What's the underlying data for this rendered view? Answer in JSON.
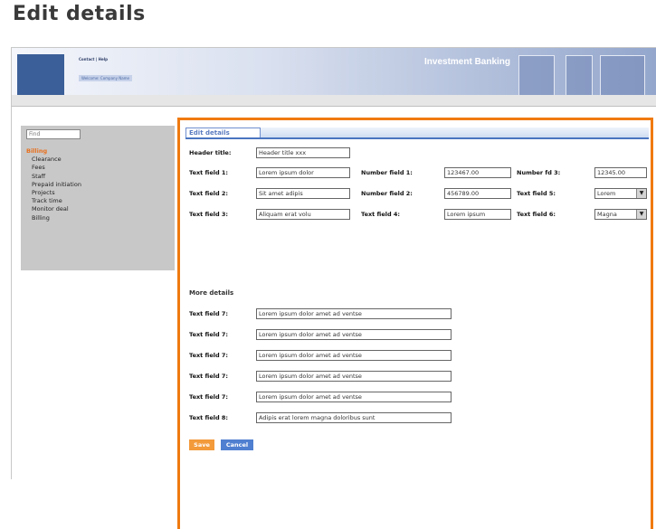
{
  "page_title": "Edit details",
  "banner": {
    "links": "Contact | Help",
    "subtitle": "Welcome: Company Name",
    "title": "Investment Banking"
  },
  "sidebar": {
    "search_placeholder": "Find",
    "items": [
      {
        "label": "Billing",
        "active": true
      },
      {
        "label": "Clearance"
      },
      {
        "label": "Fees"
      },
      {
        "label": "Staff"
      },
      {
        "label": "Prepaid initiation"
      },
      {
        "label": "Projects"
      },
      {
        "label": "Track time"
      },
      {
        "label": "Monitor deal"
      },
      {
        "label": "Billing"
      }
    ]
  },
  "form": {
    "tab_label": "Edit details",
    "header_title_label": "Header title:",
    "header_title_value": "Header title xxx",
    "row1": {
      "text1_label": "Text field 1:",
      "text1_value": "Lorem ipsum dolor",
      "num1_label": "Number field 1:",
      "num1_value": "123467.00",
      "num_fd3_label": "Number fd 3:",
      "num_fd3_value": "12345.00"
    },
    "row2": {
      "text2_label": "Text field 2:",
      "text2_value": "Sit amet adipis",
      "num2_label": "Number field 2:",
      "num2_value": "456789.00",
      "text5_label": "Text field 5:",
      "text5_value": "Lorem"
    },
    "row3": {
      "text3_label": "Text field 3:",
      "text3_value": "Aliquam erat volu",
      "text4_label": "Text field 4:",
      "text4_value": "Lorem ipsum",
      "text6_label": "Text field 6:",
      "text6_value": "Magna"
    },
    "more_details_title": "More details",
    "more_fields": [
      {
        "label": "Text field 7:",
        "value": "Lorem ipsum dolor amet ad ventse"
      },
      {
        "label": "Text field 7:",
        "value": "Lorem ipsum dolor amet ad ventse"
      },
      {
        "label": "Text field 7:",
        "value": "Lorem ipsum dolor amet ad ventse"
      },
      {
        "label": "Text field 7:",
        "value": "Lorem ipsum dolor amet ad ventse"
      },
      {
        "label": "Text field 7:",
        "value": "Lorem ipsum dolor amet ad ventse"
      },
      {
        "label": "Text field 8:",
        "value": "Adipis erat lorem magna doloribus sunt"
      }
    ],
    "save_label": "Save",
    "cancel_label": "Cancel"
  },
  "colors": {
    "accent_orange": "#f07a10",
    "brand_blue": "#3b5f98",
    "save_button": "#f39a3a",
    "cancel_button": "#4f7fd0"
  },
  "icons": {
    "select_arrow": "chevron-down-icon"
  }
}
